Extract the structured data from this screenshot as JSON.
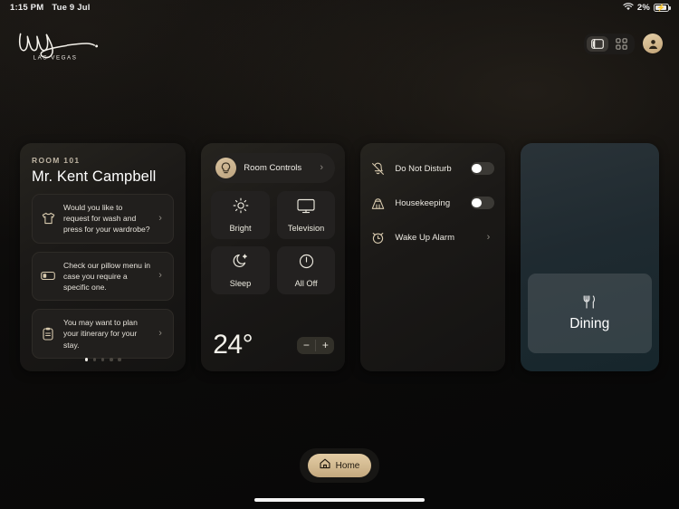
{
  "status_bar": {
    "time": "1:15 PM",
    "date": "Tue 9 Jul",
    "wifi_icon": "wifi-icon",
    "battery_percent": "2%",
    "battery_icon": "battery-charging-icon"
  },
  "header": {
    "logo_alt": "Wynn Las Vegas",
    "logo_subtitle": "LAS VEGAS",
    "view_split_icon": "split-view-icon",
    "view_grid_icon": "grid-view-icon",
    "profile_icon": "profile-avatar-icon"
  },
  "guest_card": {
    "room_label": "ROOM 101",
    "guest_name": "Mr. Kent Campbell",
    "suggestions": [
      {
        "icon": "tshirt-icon",
        "text": "Would you like to request for wash and press for your wardrobe?",
        "chevron": "chevron-right-icon"
      },
      {
        "icon": "pillow-icon",
        "text": "Check our pillow menu in case you require a specific one.",
        "chevron": "chevron-right-icon"
      },
      {
        "icon": "clipboard-icon",
        "text": "You may want to plan your itinerary for your stay.",
        "chevron": "chevron-right-icon"
      }
    ],
    "page_dots": {
      "total": 5,
      "active": 1
    }
  },
  "room_controls_card": {
    "header_label": "Room Controls",
    "header_icon": "lightbulb-icon",
    "header_chevron": "chevron-right-icon",
    "tiles": [
      {
        "label": "Bright",
        "icon": "sun-icon"
      },
      {
        "label": "Television",
        "icon": "television-icon"
      },
      {
        "label": "Sleep",
        "icon": "moon-stars-icon"
      },
      {
        "label": "All Off",
        "icon": "power-icon"
      }
    ],
    "temperature": "24°",
    "decrease_label": "−",
    "increase_label": "+"
  },
  "services_card": {
    "rows": [
      {
        "label": "Do Not Disturb",
        "icon": "bell-slash-icon",
        "control": "toggle",
        "state": "off"
      },
      {
        "label": "Housekeeping",
        "icon": "housekeeping-icon",
        "control": "toggle",
        "state": "off"
      },
      {
        "label": "Wake Up Alarm",
        "icon": "alarm-clock-icon",
        "control": "chevron",
        "state": ""
      }
    ]
  },
  "dining_card": {
    "label": "Dining",
    "icon": "fork-knife-icon"
  },
  "home_bar": {
    "label": "Home",
    "icon": "home-icon"
  },
  "colors": {
    "accent_gold": "#d4bb92",
    "background": "#0a0908",
    "card": "#1b1917",
    "dining_card": "#1f2a30"
  }
}
